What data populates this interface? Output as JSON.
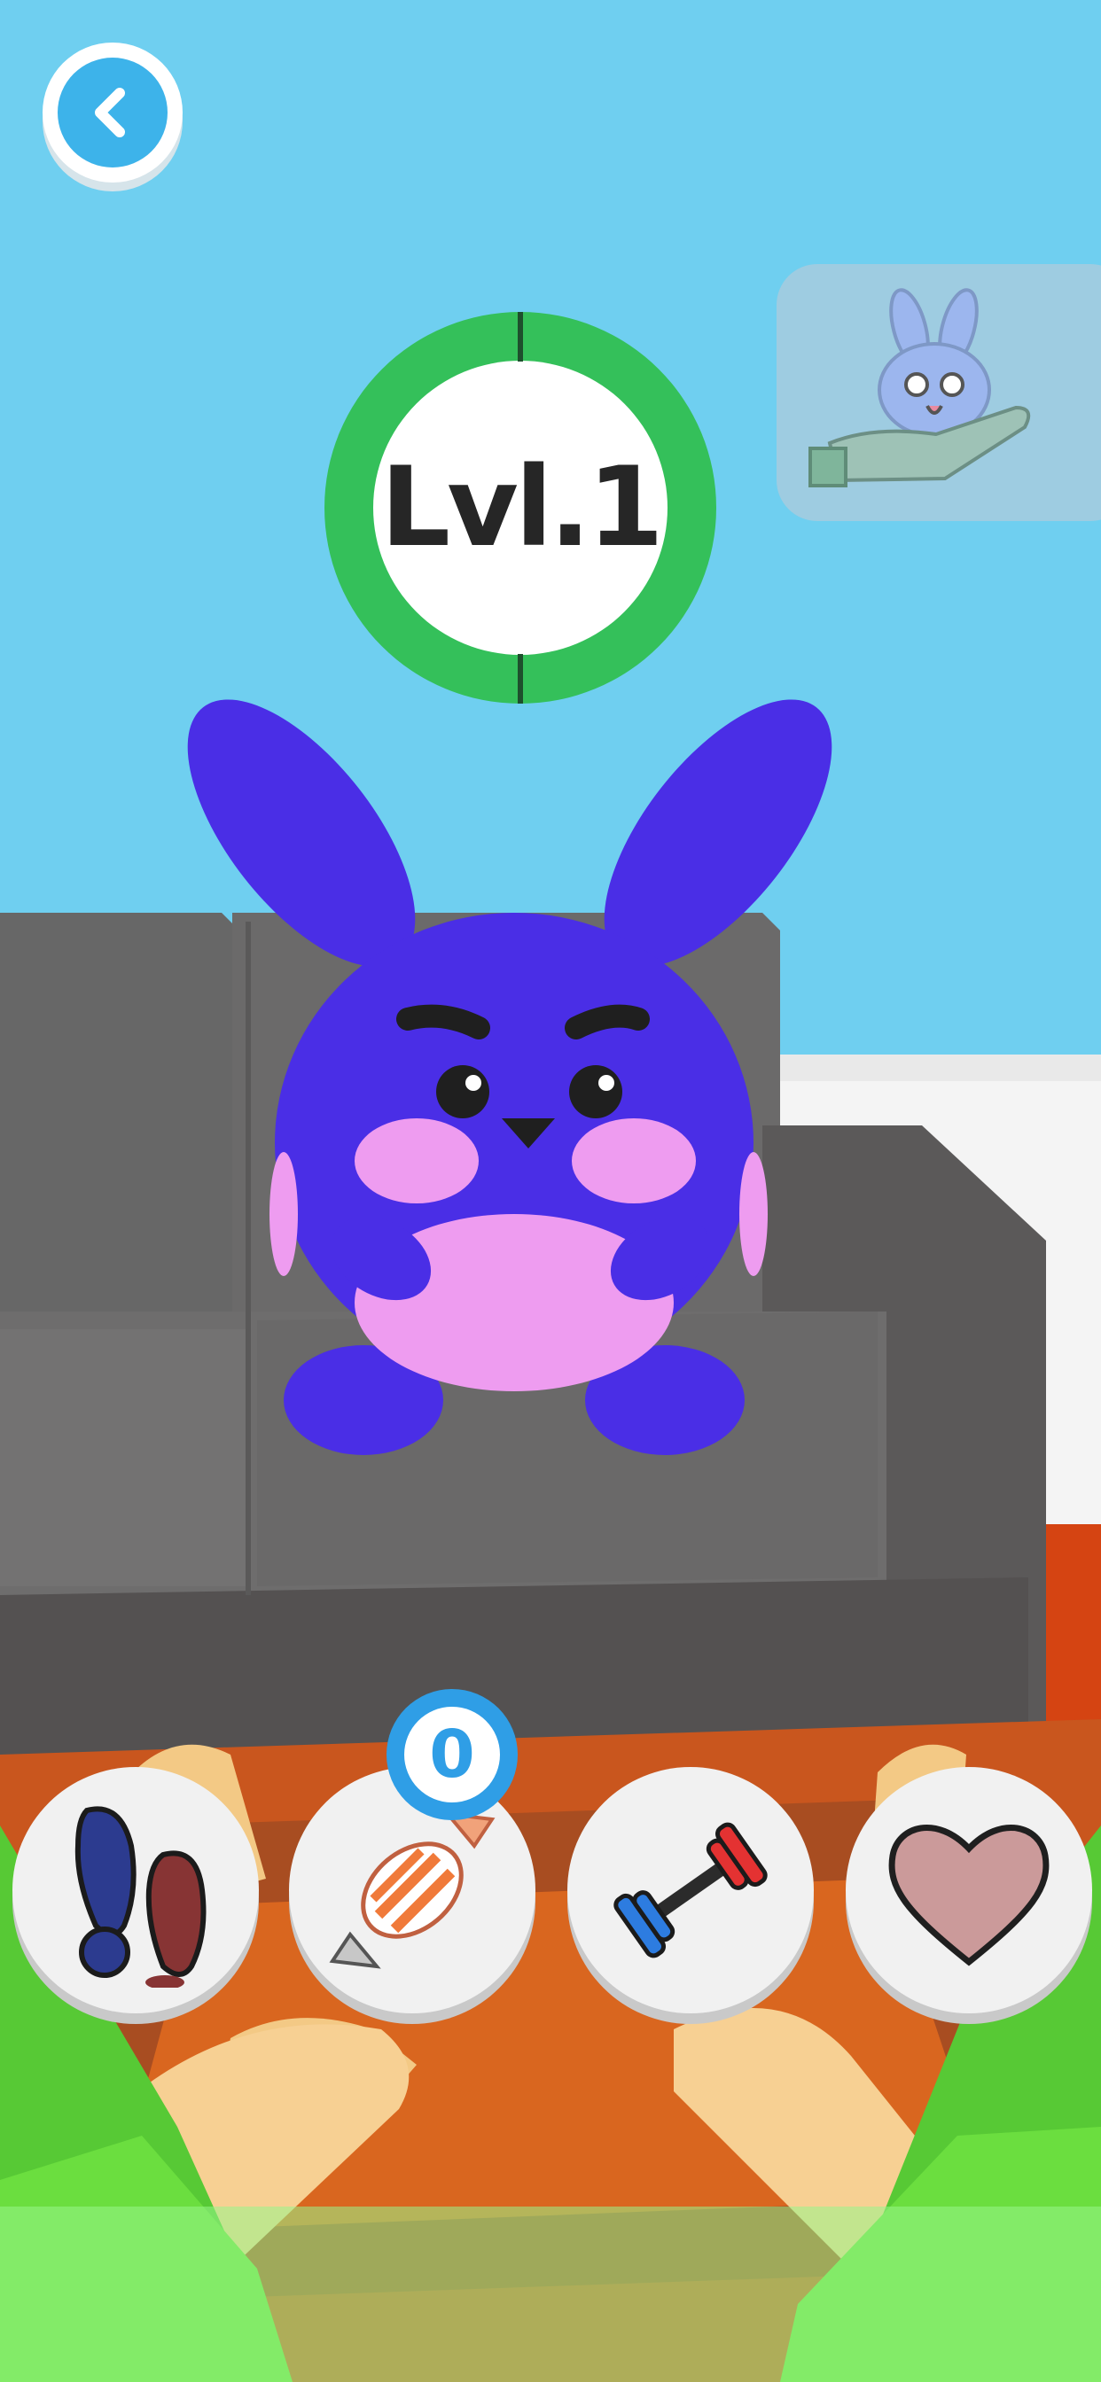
{
  "level": {
    "label": "Lvl.1",
    "progress": 0.0
  },
  "candy": {
    "count": "0"
  },
  "buttons": [
    {
      "icon": "footsteps-icon"
    },
    {
      "icon": "candy-icon"
    },
    {
      "icon": "dumbbell-icon"
    },
    {
      "icon": "heart-icon"
    }
  ],
  "top": {
    "back_icon": "chevron-left-icon",
    "pet_card_icon": "bunny-on-hand-icon"
  },
  "colors": {
    "sky": "#6fcff0",
    "ring": "#34c05a",
    "pet": "#4a2ee6",
    "pet_blush": "#ee9cf0",
    "accent_blue": "#2f9ee6"
  }
}
